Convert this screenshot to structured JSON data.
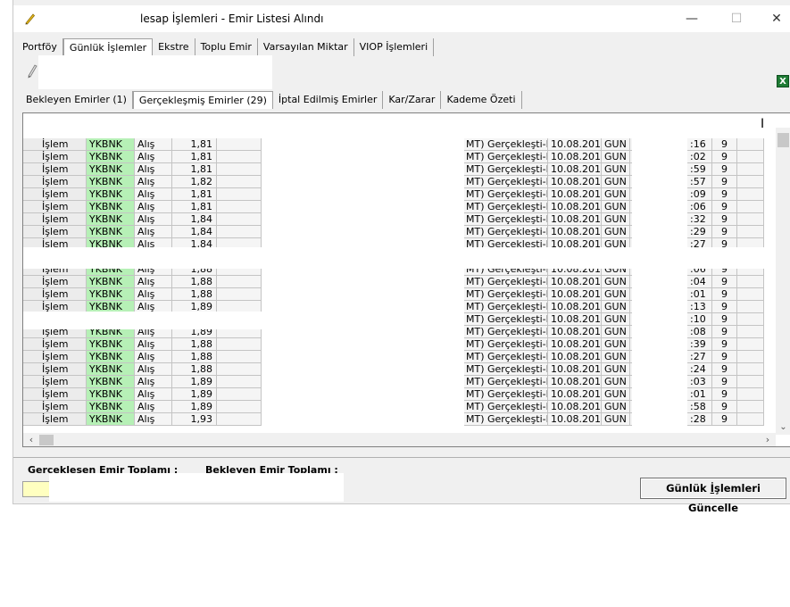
{
  "window": {
    "title": "lesap İşlemleri - Emir Listesi Alındı"
  },
  "title_buttons": {
    "minimize": "—",
    "maximize": "☐",
    "close": "✕"
  },
  "main_tabs": [
    {
      "label": "Portföy"
    },
    {
      "label": "Günlük İşlemler"
    },
    {
      "label": "Ekstre"
    },
    {
      "label": "Toplu Emir"
    },
    {
      "label": "Varsayılan Miktar"
    },
    {
      "label": "VIOP İşlemleri"
    }
  ],
  "sub_tabs": [
    {
      "label": "Bekleyen Emirler (1)"
    },
    {
      "label": "Gerçekleşmiş Emirler (29)"
    },
    {
      "label": "İptal Edilmiş Emirler"
    },
    {
      "label": "Kar/Zarar"
    },
    {
      "label": "Kademe Özeti"
    }
  ],
  "toolbar": {
    "excel_icon": "X"
  },
  "rows": [
    {
      "islem": "İşlem",
      "symbol": "YKBNK",
      "side": "Alış",
      "price": "1,81",
      "status": "MT) Gerçekleşti-DO",
      "date": "10.08.201",
      "validity": "GUN",
      "time": ":16",
      "qty": "9"
    },
    {
      "islem": "İşlem",
      "symbol": "YKBNK",
      "side": "Alış",
      "price": "1,81",
      "status": "MT) Gerçekleşti-DO",
      "date": "10.08.201",
      "validity": "GUN",
      "time": ":02",
      "qty": "9"
    },
    {
      "islem": "İşlem",
      "symbol": "YKBNK",
      "side": "Alış",
      "price": "1,81",
      "status": "MT) Gerçekleşti-DO",
      "date": "10.08.201",
      "validity": "GUN",
      "time": ":59",
      "qty": "9"
    },
    {
      "islem": "İşlem",
      "symbol": "YKBNK",
      "side": "Alış",
      "price": "1,82",
      "status": "MT) Gerçekleşti-DO",
      "date": "10.08.201",
      "validity": "GUN",
      "time": ":57",
      "qty": "9"
    },
    {
      "islem": "İşlem",
      "symbol": "YKBNK",
      "side": "Alış",
      "price": "1,81",
      "status": "MT) Gerçekleşti-DO",
      "date": "10.08.201",
      "validity": "GUN",
      "time": ":09",
      "qty": "9"
    },
    {
      "islem": "İşlem",
      "symbol": "YKBNK",
      "side": "Alış",
      "price": "1,81",
      "status": "MT) Gerçekleşti-DO",
      "date": "10.08.201",
      "validity": "GUN",
      "time": ":06",
      "qty": "9"
    },
    {
      "islem": "İşlem",
      "symbol": "YKBNK",
      "side": "Alış",
      "price": "1,84",
      "status": "MT) Gerçekleşti-DO",
      "date": "10.08.201",
      "validity": "GUN",
      "time": ":32",
      "qty": "9"
    },
    {
      "islem": "İşlem",
      "symbol": "YKBNK",
      "side": "Alış",
      "price": "1,84",
      "status": "MT) Gerçekleşti-DO",
      "date": "10.08.201",
      "validity": "GUN",
      "time": ":29",
      "qty": "9"
    },
    {
      "islem": "İşlem",
      "symbol": "YKBNK",
      "side": "Alış",
      "price": "1,84",
      "status": "MT) Gerçekleşti-DO",
      "date": "10.08.201",
      "validity": "GUN",
      "time": ":27",
      "qty": "9"
    },
    {
      "islem": "",
      "symbol": "",
      "side": "",
      "price": "",
      "status": "",
      "date": "",
      "validity": "",
      "time": "",
      "qty": ""
    },
    {
      "islem": "İşlem",
      "symbol": "YKBNK",
      "side": "Alış",
      "price": "1,88",
      "status": "MT) Gerçekleşti-DO",
      "date": "10.08.201",
      "validity": "GUN",
      "time": ":06",
      "qty": "9"
    },
    {
      "islem": "İşlem",
      "symbol": "YKBNK",
      "side": "Alış",
      "price": "1,88",
      "status": "MT) Gerçekleşti-DO",
      "date": "10.08.201",
      "validity": "GUN",
      "time": ":04",
      "qty": "9"
    },
    {
      "islem": "İşlem",
      "symbol": "YKBNK",
      "side": "Alış",
      "price": "1,88",
      "status": "MT) Gerçekleşti-DO",
      "date": "10.08.201",
      "validity": "GUN",
      "time": ":01",
      "qty": "9"
    },
    {
      "islem": "İşlem",
      "symbol": "YKBNK",
      "side": "Alış",
      "price": "1,89",
      "status": "MT) Gerçekleşti-DO",
      "date": "10.08.201",
      "validity": "GUN",
      "time": ":13",
      "qty": "9"
    },
    {
      "islem": "",
      "symbol": "",
      "side": "",
      "price": "",
      "status": "MT) Gerçekleşti-DO",
      "date": "10.08.201",
      "validity": "GUN",
      "time": ":10",
      "qty": "9"
    },
    {
      "islem": "İşlem",
      "symbol": "YKBNK",
      "side": "Alış",
      "price": "1,89",
      "status": "MT) Gerçekleşti-DO",
      "date": "10.08.201",
      "validity": "GUN",
      "time": ":08",
      "qty": "9"
    },
    {
      "islem": "İşlem",
      "symbol": "YKBNK",
      "side": "Alış",
      "price": "1,88",
      "status": "MT) Gerçekleşti-DO",
      "date": "10.08.201",
      "validity": "GUN",
      "time": ":39",
      "qty": "9"
    },
    {
      "islem": "İşlem",
      "symbol": "YKBNK",
      "side": "Alış",
      "price": "1,88",
      "status": "MT) Gerçekleşti-DO",
      "date": "10.08.201",
      "validity": "GUN",
      "time": ":27",
      "qty": "9"
    },
    {
      "islem": "İşlem",
      "symbol": "YKBNK",
      "side": "Alış",
      "price": "1,88",
      "status": "MT) Gerçekleşti-DO",
      "date": "10.08.201",
      "validity": "GUN",
      "time": ":24",
      "qty": "9"
    },
    {
      "islem": "İşlem",
      "symbol": "YKBNK",
      "side": "Alış",
      "price": "1,89",
      "status": "MT) Gerçekleşti-DO",
      "date": "10.08.201",
      "validity": "GUN",
      "time": ":03",
      "qty": "9"
    },
    {
      "islem": "İşlem",
      "symbol": "YKBNK",
      "side": "Alış",
      "price": "1,89",
      "status": "MT) Gerçekleşti-DO",
      "date": "10.08.201",
      "validity": "GUN",
      "time": ":01",
      "qty": "9"
    },
    {
      "islem": "İşlem",
      "symbol": "YKBNK",
      "side": "Alış",
      "price": "1,89",
      "status": "MT) Gerçekleşti-DO",
      "date": "10.08.201",
      "validity": "GUN",
      "time": ":58",
      "qty": "9"
    },
    {
      "islem": "İşlem",
      "symbol": "YKBNK",
      "side": "Alış",
      "price": "1,93",
      "status": "MT) Gerçekleşti-DO",
      "date": "10.08.201",
      "validity": "GUN",
      "time": ":28",
      "qty": "9"
    }
  ],
  "footer": {
    "executed_total_label": "Gerçekleşen Emir Toplamı :",
    "pending_total_label": "Bekleyen Emir Toplamı :",
    "update_button_label": "Günlük İşlemleri Güncelle",
    "update_button_mnemonic": "İ"
  },
  "colors": {
    "symbol_cell_bg": "#b6f0b6",
    "total_box_bg": "#ffffc0",
    "excel_green": "#1e7b34"
  },
  "icons": {
    "app": "pen-icon",
    "toolbar": "pencil-icon",
    "export": "excel-icon",
    "scroll_down": "chevron-down-icon",
    "scroll_left": "chevron-left-icon",
    "scroll_right": "chevron-right-icon"
  }
}
